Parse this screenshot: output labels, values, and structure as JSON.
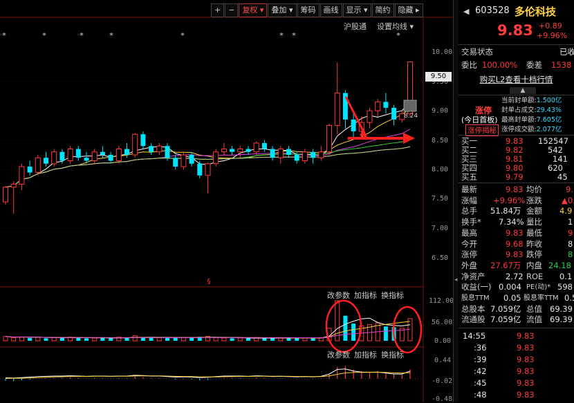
{
  "toolbar": {
    "buttons": [
      "+",
      "−",
      "复权",
      "叠加",
      "筹码",
      "画线",
      "显示",
      "简约",
      "隐藏"
    ]
  },
  "chart": {
    "top_links": [
      "沪股通",
      "设置均线"
    ],
    "price_ticks": [
      "10.00",
      "9.50",
      "9.00",
      "8.50",
      "8.00",
      "7.50",
      "7.00",
      "6.50"
    ],
    "current_price_tag": "9.50",
    "vol_links": [
      "改参数",
      "加指标",
      "换指标"
    ],
    "vol_ticks": [
      "112.00",
      "56.00",
      "0.00"
    ],
    "macd_links": [
      "改参数",
      "加指标",
      "换指标"
    ],
    "macd_ticks": [
      "0.44",
      "-0.02",
      "-0.48"
    ],
    "annotation_value": "8.24",
    "candles": [
      [
        7.45,
        7.7,
        7.4,
        7.72,
        0
      ],
      [
        7.7,
        7.75,
        7.25,
        7.8,
        0
      ],
      [
        7.75,
        8.05,
        7.65,
        8.1,
        0
      ],
      [
        8.05,
        7.95,
        7.9,
        8.15,
        1
      ],
      [
        7.95,
        8.2,
        7.9,
        8.25,
        0
      ],
      [
        8.2,
        8.1,
        8.05,
        8.3,
        1
      ],
      [
        8.1,
        8.3,
        8.05,
        8.35,
        0
      ],
      [
        8.3,
        8.15,
        8.1,
        8.35,
        1
      ],
      [
        8.15,
        8.35,
        8.1,
        8.4,
        0
      ],
      [
        8.35,
        8.2,
        8.15,
        8.4,
        1
      ],
      [
        8.2,
        8.15,
        8.1,
        8.3,
        1
      ],
      [
        8.15,
        8.3,
        8.1,
        8.35,
        0
      ],
      [
        8.3,
        8.25,
        8.2,
        8.4,
        1
      ],
      [
        8.25,
        8.15,
        8.1,
        8.3,
        1
      ],
      [
        8.15,
        8.35,
        8.1,
        8.4,
        0
      ],
      [
        8.35,
        8.25,
        8.2,
        8.45,
        1
      ],
      [
        8.25,
        8.6,
        8.2,
        8.62,
        0
      ],
      [
        8.6,
        8.4,
        8.35,
        8.65,
        1
      ],
      [
        8.4,
        8.3,
        8.25,
        8.45,
        1
      ],
      [
        8.3,
        8.4,
        8.25,
        8.45,
        0
      ],
      [
        8.4,
        8.2,
        8.15,
        8.45,
        1
      ],
      [
        8.2,
        8.05,
        8.0,
        8.25,
        1
      ],
      [
        8.05,
        8.25,
        8.0,
        8.3,
        0
      ],
      [
        8.25,
        8.1,
        8.05,
        8.3,
        1
      ],
      [
        8.1,
        7.9,
        7.85,
        8.15,
        1
      ],
      [
        7.9,
        8.1,
        7.6,
        8.12,
        0
      ],
      [
        8.1,
        8.3,
        8.05,
        8.35,
        0
      ],
      [
        8.3,
        8.35,
        8.25,
        8.45,
        0
      ],
      [
        8.35,
        8.3,
        8.25,
        8.4,
        1
      ],
      [
        8.3,
        8.35,
        8.2,
        8.4,
        0
      ],
      [
        8.35,
        8.3,
        8.25,
        8.4,
        1
      ],
      [
        8.3,
        8.45,
        8.25,
        8.48,
        0
      ],
      [
        8.45,
        8.35,
        8.3,
        8.5,
        1
      ],
      [
        8.35,
        8.2,
        8.15,
        8.4,
        1
      ],
      [
        8.2,
        8.35,
        8.1,
        8.4,
        0
      ],
      [
        8.35,
        8.25,
        8.2,
        8.4,
        1
      ],
      [
        8.25,
        8.15,
        8.1,
        8.3,
        1
      ],
      [
        8.15,
        8.3,
        8.1,
        8.35,
        0
      ],
      [
        8.3,
        8.2,
        8.1,
        8.35,
        1
      ],
      [
        8.2,
        8.3,
        8.15,
        8.4,
        0
      ],
      [
        8.3,
        8.75,
        8.25,
        8.78,
        0
      ],
      [
        8.75,
        9.3,
        8.6,
        9.82,
        0
      ],
      [
        9.3,
        8.85,
        8.7,
        9.35,
        1
      ],
      [
        8.85,
        8.65,
        8.55,
        8.95,
        1
      ],
      [
        8.65,
        8.8,
        8.55,
        8.9,
        0
      ],
      [
        8.8,
        9.0,
        8.7,
        9.05,
        0
      ],
      [
        9.0,
        9.15,
        8.9,
        9.2,
        0
      ],
      [
        9.15,
        9.05,
        8.95,
        9.3,
        1
      ],
      [
        9.05,
        8.85,
        8.75,
        9.1,
        1
      ],
      [
        8.85,
        8.95,
        8.8,
        9.0,
        0
      ],
      [
        8.95,
        9.83,
        8.9,
        9.83,
        0
      ]
    ],
    "volumes": [
      12,
      9,
      11,
      8,
      10,
      7,
      9,
      8,
      10,
      9,
      7,
      8,
      9,
      7,
      10,
      8,
      14,
      9,
      8,
      9,
      8,
      10,
      9,
      8,
      11,
      12,
      9,
      8,
      7,
      8,
      7,
      9,
      8,
      7,
      9,
      8,
      7,
      8,
      7,
      9,
      35,
      112,
      70,
      48,
      42,
      45,
      50,
      40,
      38,
      35,
      62
    ],
    "macd": [
      -0.05,
      -0.06,
      -0.04,
      -0.02,
      0.0,
      0.01,
      0.02,
      0.02,
      0.03,
      0.02,
      0.01,
      0.02,
      0.02,
      0.01,
      0.02,
      0.02,
      0.05,
      0.04,
      0.02,
      0.02,
      0.0,
      -0.02,
      -0.01,
      -0.02,
      -0.04,
      -0.03,
      0.0,
      0.02,
      0.02,
      0.02,
      0.01,
      0.03,
      0.02,
      0.0,
      0.01,
      0.0,
      -0.01,
      0.0,
      -0.01,
      0.01,
      0.1,
      0.28,
      0.3,
      0.22,
      0.18,
      0.17,
      0.18,
      0.14,
      0.1,
      0.1,
      0.22
    ]
  },
  "panel": {
    "code": "603528",
    "name": "多伦科技",
    "price": "9.83",
    "change": "+0.89",
    "change_pct": "+9.96%",
    "status_label": "交易状态",
    "status_value": "已收",
    "weibi_label": "委比",
    "weibi_value": "100.00%",
    "weicha_label": "委差",
    "weicha_value": "1538",
    "l2_link": "购买L2查看十档行情",
    "limit_title": "涨停",
    "limit_sub": "(今日首板)",
    "limit_btn": "涨停揭秘",
    "limit_stats": [
      {
        "label": "当前封单额:",
        "value": "1.500亿"
      },
      {
        "label": "封单占成交:",
        "value": "29.43%"
      },
      {
        "label": "最高封单额:",
        "value": "7.605亿"
      },
      {
        "label": "涨停成交额:",
        "value": "2.077亿"
      }
    ],
    "bids": [
      {
        "label": "买一",
        "price": "9.83",
        "vol": "152547"
      },
      {
        "label": "买二",
        "price": "9.82",
        "vol": "542"
      },
      {
        "label": "买三",
        "price": "9.81",
        "vol": "141"
      },
      {
        "label": "买四",
        "price": "9.80",
        "vol": "620"
      },
      {
        "label": "买五",
        "price": "9.79",
        "vol": "45"
      }
    ],
    "stats": [
      {
        "l1": "最新",
        "v1": "9.83",
        "c1": "red",
        "l2": "均价",
        "v2": "9.",
        "c2": "red"
      },
      {
        "l1": "涨幅",
        "v1": "+9.96%",
        "c1": "red",
        "l2": "涨跌",
        "v2": "▲0.",
        "c2": "red"
      },
      {
        "l1": "总手",
        "v1": "51.84万",
        "c1": "white",
        "l2": "金额",
        "v2": "4.9",
        "c2": "yellow"
      },
      {
        "l1": "换手*",
        "v1": "7.34%",
        "c1": "white",
        "l2": "量比",
        "v2": "1",
        "c2": "white"
      },
      {
        "l1": "最高",
        "v1": "9.83",
        "c1": "red",
        "l2": "最低",
        "v2": "9",
        "c2": "red"
      },
      {
        "l1": "今开",
        "v1": "9.68",
        "c1": "red",
        "l2": "昨收",
        "v2": "8",
        "c2": "white"
      },
      {
        "l1": "涨停",
        "v1": "9.83",
        "c1": "red",
        "l2": "跌停",
        "v2": "8",
        "c2": "green"
      },
      {
        "l1": "外盘",
        "v1": "27.67万",
        "c1": "red",
        "l2": "内盘",
        "v2": "24.18",
        "c2": "green"
      },
      {
        "l1": "净资产",
        "v1": "2.72",
        "c1": "white",
        "l2": "ROE",
        "v2": "0.1",
        "c2": "white"
      },
      {
        "l1": "收益(一)",
        "v1": "0.004",
        "c1": "white",
        "l2": "PE(动)*",
        "v2": "598",
        "c2": "white"
      },
      {
        "l1": "股息TTM",
        "v1": "0.05",
        "c1": "white",
        "l2": "股息率TTM",
        "v2": "0.5",
        "c2": "white"
      },
      {
        "l1": "总股本",
        "v1": "7.059亿",
        "c1": "white",
        "l2": "总值",
        "v2": "69.39",
        "c2": "white"
      },
      {
        "l1": "流通股",
        "v1": "7.059亿",
        "c1": "white",
        "l2": "流值",
        "v2": "69.39",
        "c2": "white"
      }
    ],
    "ticks": [
      {
        "time": "14:55",
        "price": "9.83"
      },
      {
        "time": ":36",
        "price": "9.83"
      },
      {
        "time": ":39",
        "price": "9.83"
      },
      {
        "time": ":42",
        "price": "9.83"
      },
      {
        "time": ":45",
        "price": "9.83"
      },
      {
        "time": ":48",
        "price": "9.83"
      }
    ]
  }
}
